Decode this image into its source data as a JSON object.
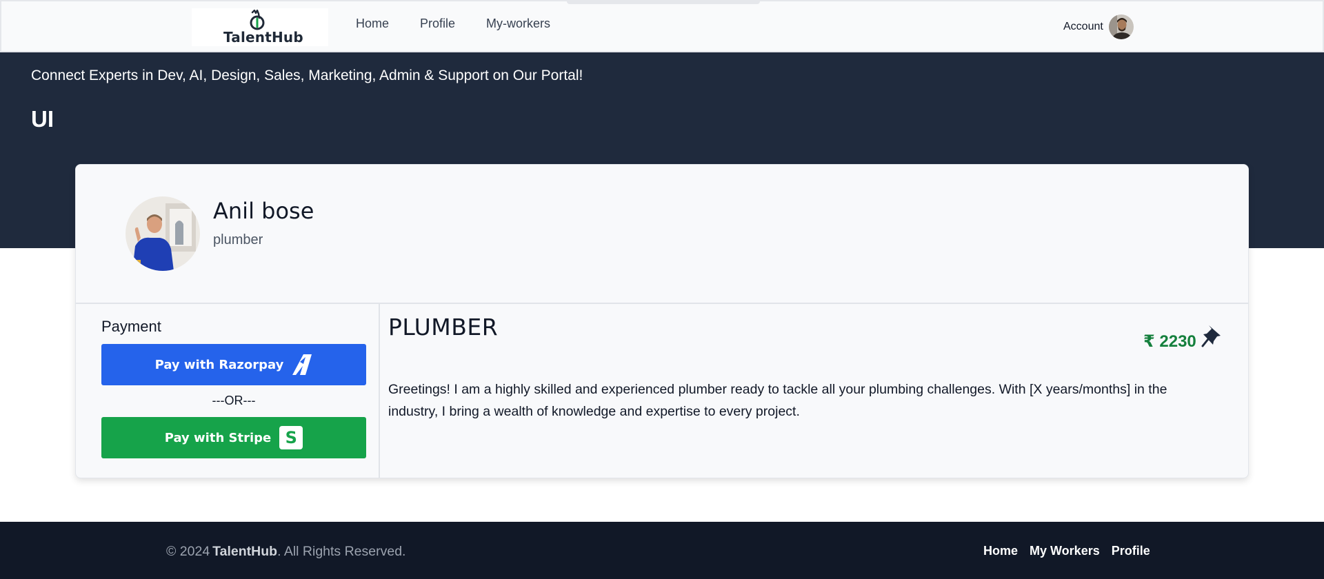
{
  "nav": {
    "logo_text": "TalentHub",
    "links": [
      "Home",
      "Profile",
      "My-workers"
    ],
    "account_label": "Account"
  },
  "hero": {
    "tagline": "Connect Experts in Dev, AI, Design, Sales, Marketing, Admin & Support on Our Portal!",
    "title": "UI"
  },
  "profile": {
    "name": "Anil bose",
    "role": "plumber"
  },
  "payment": {
    "title": "Payment",
    "razorpay_label": "Pay with Razorpay",
    "or_label": "---OR---",
    "stripe_label": "Pay with Stripe",
    "stripe_icon_text": "S"
  },
  "job": {
    "title": "PLUMBER",
    "price": "₹ 2230",
    "description": "Greetings! I am a highly skilled and experienced plumber ready to tackle all your plumbing challenges. With [X years/months] in the industry, I bring a wealth of knowledge and expertise to every project."
  },
  "footer": {
    "copyright_prefix": "© 2024",
    "brand": "TalentHub",
    "copyright_suffix": ". All Rights Reserved.",
    "links": [
      "Home",
      "My Workers",
      "Profile"
    ]
  },
  "colors": {
    "hero_bg": "#1f2a3d",
    "razorpay_blue": "#2563eb",
    "stripe_green": "#16a34a",
    "price_green": "#15803d",
    "footer_bg": "#111827"
  },
  "icons": [
    "talenthub-logo-icon",
    "user-avatar",
    "razorpay-icon",
    "stripe-icon",
    "pin-icon"
  ]
}
